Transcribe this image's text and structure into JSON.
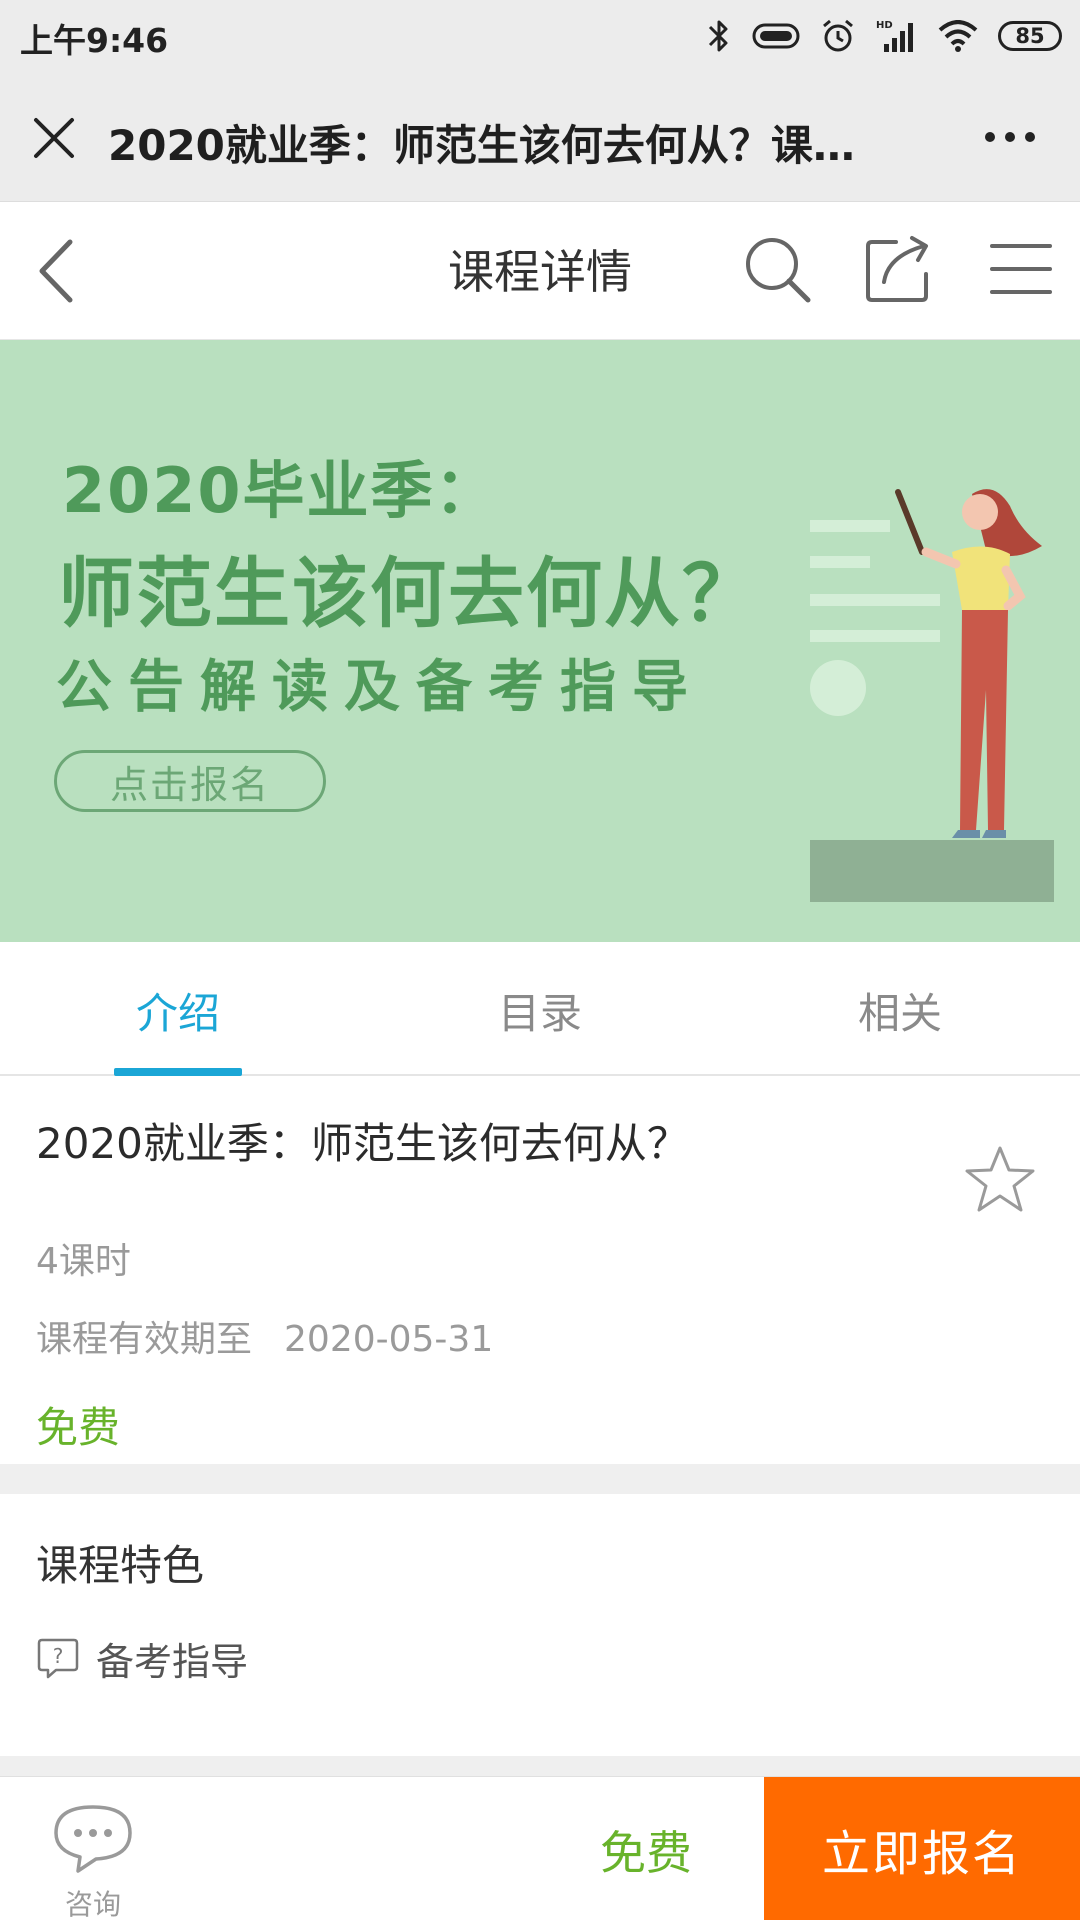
{
  "status_bar": {
    "time": "上午9:46",
    "battery": "85",
    "icons": [
      "bluetooth-icon",
      "vibrate-icon",
      "alarm-icon",
      "signal-hd-icon",
      "wifi-icon",
      "battery-icon"
    ]
  },
  "title_bar": {
    "title": "2020就业季：师范生该何去何从？课…",
    "icons": [
      "close-icon",
      "more-icon"
    ]
  },
  "nav_bar": {
    "title": "课程详情",
    "icons": [
      "back-icon",
      "search-icon",
      "share-icon",
      "menu-icon"
    ]
  },
  "banner": {
    "line1": "2020毕业季：",
    "line2": "师范生该何去何从？",
    "line3": "公告解读及备考指导",
    "button": "点击报名",
    "colors": {
      "background": "#b9e0bf",
      "text": "#4f9a5a"
    }
  },
  "tabs": [
    {
      "label": "介绍",
      "active": true
    },
    {
      "label": "目录",
      "active": false
    },
    {
      "label": "相关",
      "active": false
    }
  ],
  "course": {
    "title": "2020就业季：师范生该何去何从？",
    "lessons": "4课时",
    "validity_label": "课程有效期至",
    "validity_date": "2020-05-31",
    "price": "免费",
    "favorite_icon": "star-outline-icon"
  },
  "features": {
    "title": "课程特色",
    "items": [
      {
        "icon": "question-bubble-icon",
        "label": "备考指导"
      }
    ]
  },
  "bottom_bar": {
    "consult_label": "咨询",
    "consult_icon": "chat-bubble-icon",
    "price": "免费",
    "enroll_label": "立即报名"
  },
  "colors": {
    "accent": "#1ba6d6",
    "price_green": "#68b32b",
    "enroll_orange": "#ff6a00"
  }
}
